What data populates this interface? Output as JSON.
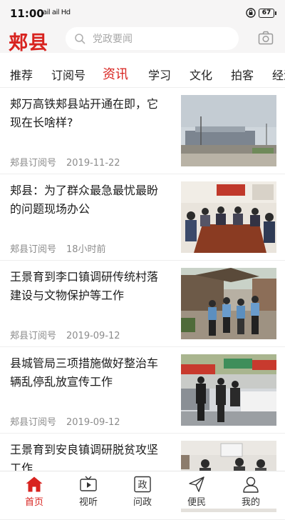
{
  "status_bar": {
    "time": "11:00",
    "network": "ail ail Hd",
    "battery": "67"
  },
  "header": {
    "logo": "郏县",
    "search_placeholder": "党政要闻"
  },
  "tabs": [
    {
      "label": "推荐",
      "active": false
    },
    {
      "label": "订阅号",
      "active": false
    },
    {
      "label": "资讯",
      "active": true
    },
    {
      "label": "学习",
      "active": false
    },
    {
      "label": "文化",
      "active": false
    },
    {
      "label": "拍客",
      "active": false
    },
    {
      "label": "经济",
      "active": false
    }
  ],
  "articles": [
    {
      "title": "郏万高铁郏县站开通在即，它现在长啥样?",
      "source": "郏县订阅号",
      "date": "2019-11-22"
    },
    {
      "title": "郏县：为了群众最急最忧最盼的问题现场办公",
      "source": "郏县订阅号",
      "date": "18小时前"
    },
    {
      "title": "王景育到李口镇调研传统村落建设与文物保护等工作",
      "source": "郏县订阅号",
      "date": "2019-09-12"
    },
    {
      "title": "县城管局三项措施做好整治车辆乱停乱放宣传工作",
      "source": "郏县订阅号",
      "date": "2019-09-12"
    },
    {
      "title": "王景育到安良镇调研脱贫攻坚工作",
      "source": "",
      "date": ""
    }
  ],
  "bottom_nav": [
    {
      "label": "首页",
      "icon": "home-icon",
      "active": true
    },
    {
      "label": "视听",
      "icon": "tv-icon",
      "active": false
    },
    {
      "label": "问政",
      "icon": "politics-icon",
      "icon_text": "政",
      "active": false
    },
    {
      "label": "便民",
      "icon": "send-icon",
      "active": false
    },
    {
      "label": "我的",
      "icon": "user-icon",
      "active": false
    }
  ],
  "colors": {
    "brand_red": "#d8231f",
    "header_bg": "#f6f5f5",
    "meta_gray": "#8c8c8c"
  }
}
